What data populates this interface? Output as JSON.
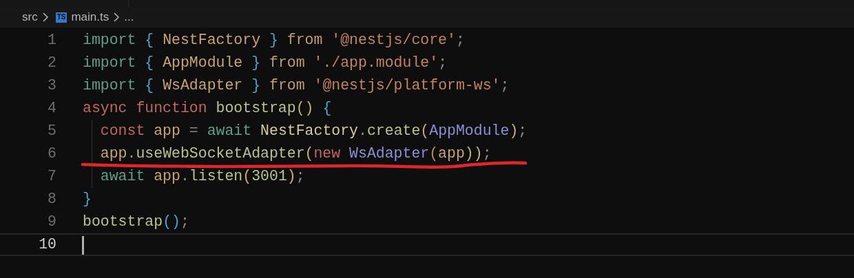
{
  "breadcrumb": {
    "folder": "src",
    "file_icon_label": "TS",
    "file": "main.ts",
    "symbol": "..."
  },
  "lines": [
    {
      "number": "1",
      "current": false,
      "tokens": [
        {
          "text": "import ",
          "kind": "import"
        },
        {
          "text": "{",
          "kind": "brace"
        },
        {
          "text": " NestFactory ",
          "kind": "variable"
        },
        {
          "text": "}",
          "kind": "brace"
        },
        {
          "text": " from ",
          "kind": "from"
        },
        {
          "text": "'@nestjs/core'",
          "kind": "string"
        },
        {
          "text": ";",
          "kind": "punct"
        }
      ]
    },
    {
      "number": "2",
      "current": false,
      "tokens": [
        {
          "text": "import ",
          "kind": "import"
        },
        {
          "text": "{",
          "kind": "brace"
        },
        {
          "text": " AppModule ",
          "kind": "variable"
        },
        {
          "text": "}",
          "kind": "brace"
        },
        {
          "text": " from ",
          "kind": "from"
        },
        {
          "text": "'./app.module'",
          "kind": "string"
        },
        {
          "text": ";",
          "kind": "punct"
        }
      ]
    },
    {
      "number": "3",
      "current": false,
      "tokens": [
        {
          "text": "import ",
          "kind": "import"
        },
        {
          "text": "{",
          "kind": "brace"
        },
        {
          "text": " WsAdapter ",
          "kind": "variable"
        },
        {
          "text": "}",
          "kind": "brace"
        },
        {
          "text": " from ",
          "kind": "from"
        },
        {
          "text": "'@nestjs/platform-ws'",
          "kind": "string"
        },
        {
          "text": ";",
          "kind": "punct"
        }
      ]
    },
    {
      "number": "4",
      "current": false,
      "tokens": [
        {
          "text": "async function ",
          "kind": "storage"
        },
        {
          "text": "bootstrap",
          "kind": "function"
        },
        {
          "text": "() ",
          "kind": "paren"
        },
        {
          "text": "{",
          "kind": "brace"
        }
      ]
    },
    {
      "number": "5",
      "current": false,
      "tokens": [
        {
          "text": "  const ",
          "kind": "storage"
        },
        {
          "text": "app",
          "kind": "variable"
        },
        {
          "text": " = ",
          "kind": "punct"
        },
        {
          "text": "await ",
          "kind": "import"
        },
        {
          "text": "NestFactory",
          "kind": "class"
        },
        {
          "text": ".",
          "kind": "punct"
        },
        {
          "text": "create",
          "kind": "function"
        },
        {
          "text": "(",
          "kind": "paren"
        },
        {
          "text": "AppModule",
          "kind": "type"
        },
        {
          "text": ")",
          "kind": "paren"
        },
        {
          "text": ";",
          "kind": "punct"
        }
      ]
    },
    {
      "number": "6",
      "current": false,
      "tokens": [
        {
          "text": "  app",
          "kind": "variable"
        },
        {
          "text": ".",
          "kind": "punct"
        },
        {
          "text": "useWebSocketAdapter",
          "kind": "function"
        },
        {
          "text": "(",
          "kind": "paren"
        },
        {
          "text": "new ",
          "kind": "storage"
        },
        {
          "text": "WsAdapter",
          "kind": "type"
        },
        {
          "text": "(",
          "kind": "paren2"
        },
        {
          "text": "app",
          "kind": "variable"
        },
        {
          "text": "))",
          "kind": "paren"
        },
        {
          "text": ";",
          "kind": "punct"
        }
      ]
    },
    {
      "number": "7",
      "current": false,
      "tokens": [
        {
          "text": "  await ",
          "kind": "import"
        },
        {
          "text": "app",
          "kind": "variable"
        },
        {
          "text": ".",
          "kind": "punct"
        },
        {
          "text": "listen",
          "kind": "function"
        },
        {
          "text": "(",
          "kind": "paren"
        },
        {
          "text": "3001",
          "kind": "number"
        },
        {
          "text": ")",
          "kind": "paren"
        },
        {
          "text": ";",
          "kind": "punct"
        }
      ]
    },
    {
      "number": "8",
      "current": false,
      "tokens": [
        {
          "text": "}",
          "kind": "brace"
        }
      ]
    },
    {
      "number": "9",
      "current": false,
      "tokens": [
        {
          "text": "bootstrap",
          "kind": "function"
        },
        {
          "text": "()",
          "kind": "brace"
        },
        {
          "text": ";",
          "kind": "punct"
        }
      ]
    },
    {
      "number": "10",
      "current": true
    }
  ]
}
